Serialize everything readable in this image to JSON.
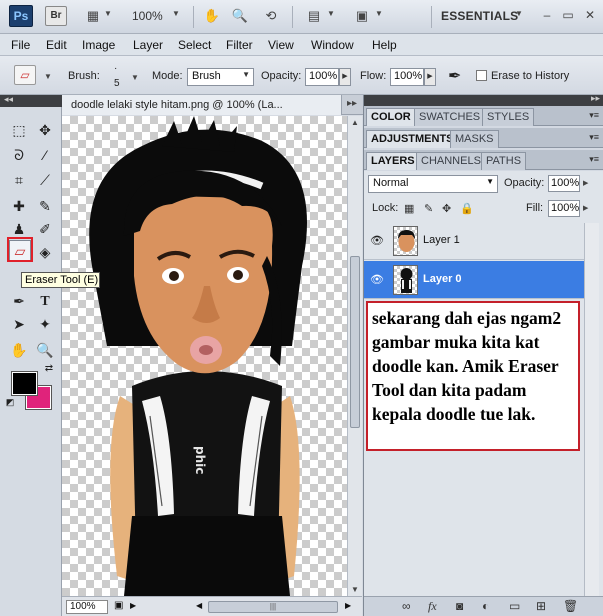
{
  "appbar": {
    "ps_logo": "Ps",
    "br_logo": "Br",
    "zoom": "100%",
    "workspace": "ESSENTIALS",
    "icons": [
      "photoshop-logo",
      "bridge-logo",
      "view-extras-icon",
      "hand-icon",
      "zoom-icon",
      "rotate-view-icon",
      "arrange-documents-icon",
      "screen-mode-icon"
    ]
  },
  "menu": [
    "File",
    "Edit",
    "Image",
    "Layer",
    "Select",
    "Filter",
    "View",
    "Window",
    "Help"
  ],
  "options": {
    "brush_label": "Brush:",
    "brush_size": "5",
    "mode_label": "Mode:",
    "mode_value": "Brush",
    "opacity_label": "Opacity:",
    "opacity_value": "100%",
    "flow_label": "Flow:",
    "flow_value": "100%",
    "erase_history_label": "Erase to History"
  },
  "toolbox": {
    "tooltip": "Eraser Tool (E)",
    "foreground_color": "#000000",
    "background_color": "#e0237b",
    "tools": [
      "marquee",
      "move",
      "lasso",
      "quick-selection",
      "crop",
      "eyedropper",
      "spot-healing",
      "brush",
      "clone-stamp",
      "history-brush",
      "eraser",
      "paint-bucket",
      "dodge",
      "pen",
      "type",
      "path-selection",
      "shape",
      "hand",
      "zoom"
    ]
  },
  "document": {
    "tab_title": "doodle lelaki style hitam.png @ 100% (La...",
    "zoom": "100%"
  },
  "panels": {
    "row1_tabs": [
      "COLOR",
      "SWATCHES",
      "STYLES"
    ],
    "row2_tabs": [
      "ADJUSTMENTS",
      "MASKS"
    ],
    "row3_tabs": [
      "LAYERS",
      "CHANNELS",
      "PATHS"
    ],
    "blend_mode": "Normal",
    "opacity_label": "Opacity:",
    "opacity_value": "100%",
    "lock_label": "Lock:",
    "fill_label": "Fill:",
    "fill_value": "100%",
    "layers": [
      {
        "name": "Layer 1",
        "selected": false
      },
      {
        "name": "Layer 0",
        "selected": true
      }
    ]
  },
  "annotation": {
    "text": "sekarang dah ejas ngam2 gambar muka kita kat doodle kan. Amik Eraser Tool dan kita padam kepala doodle tue lak."
  }
}
